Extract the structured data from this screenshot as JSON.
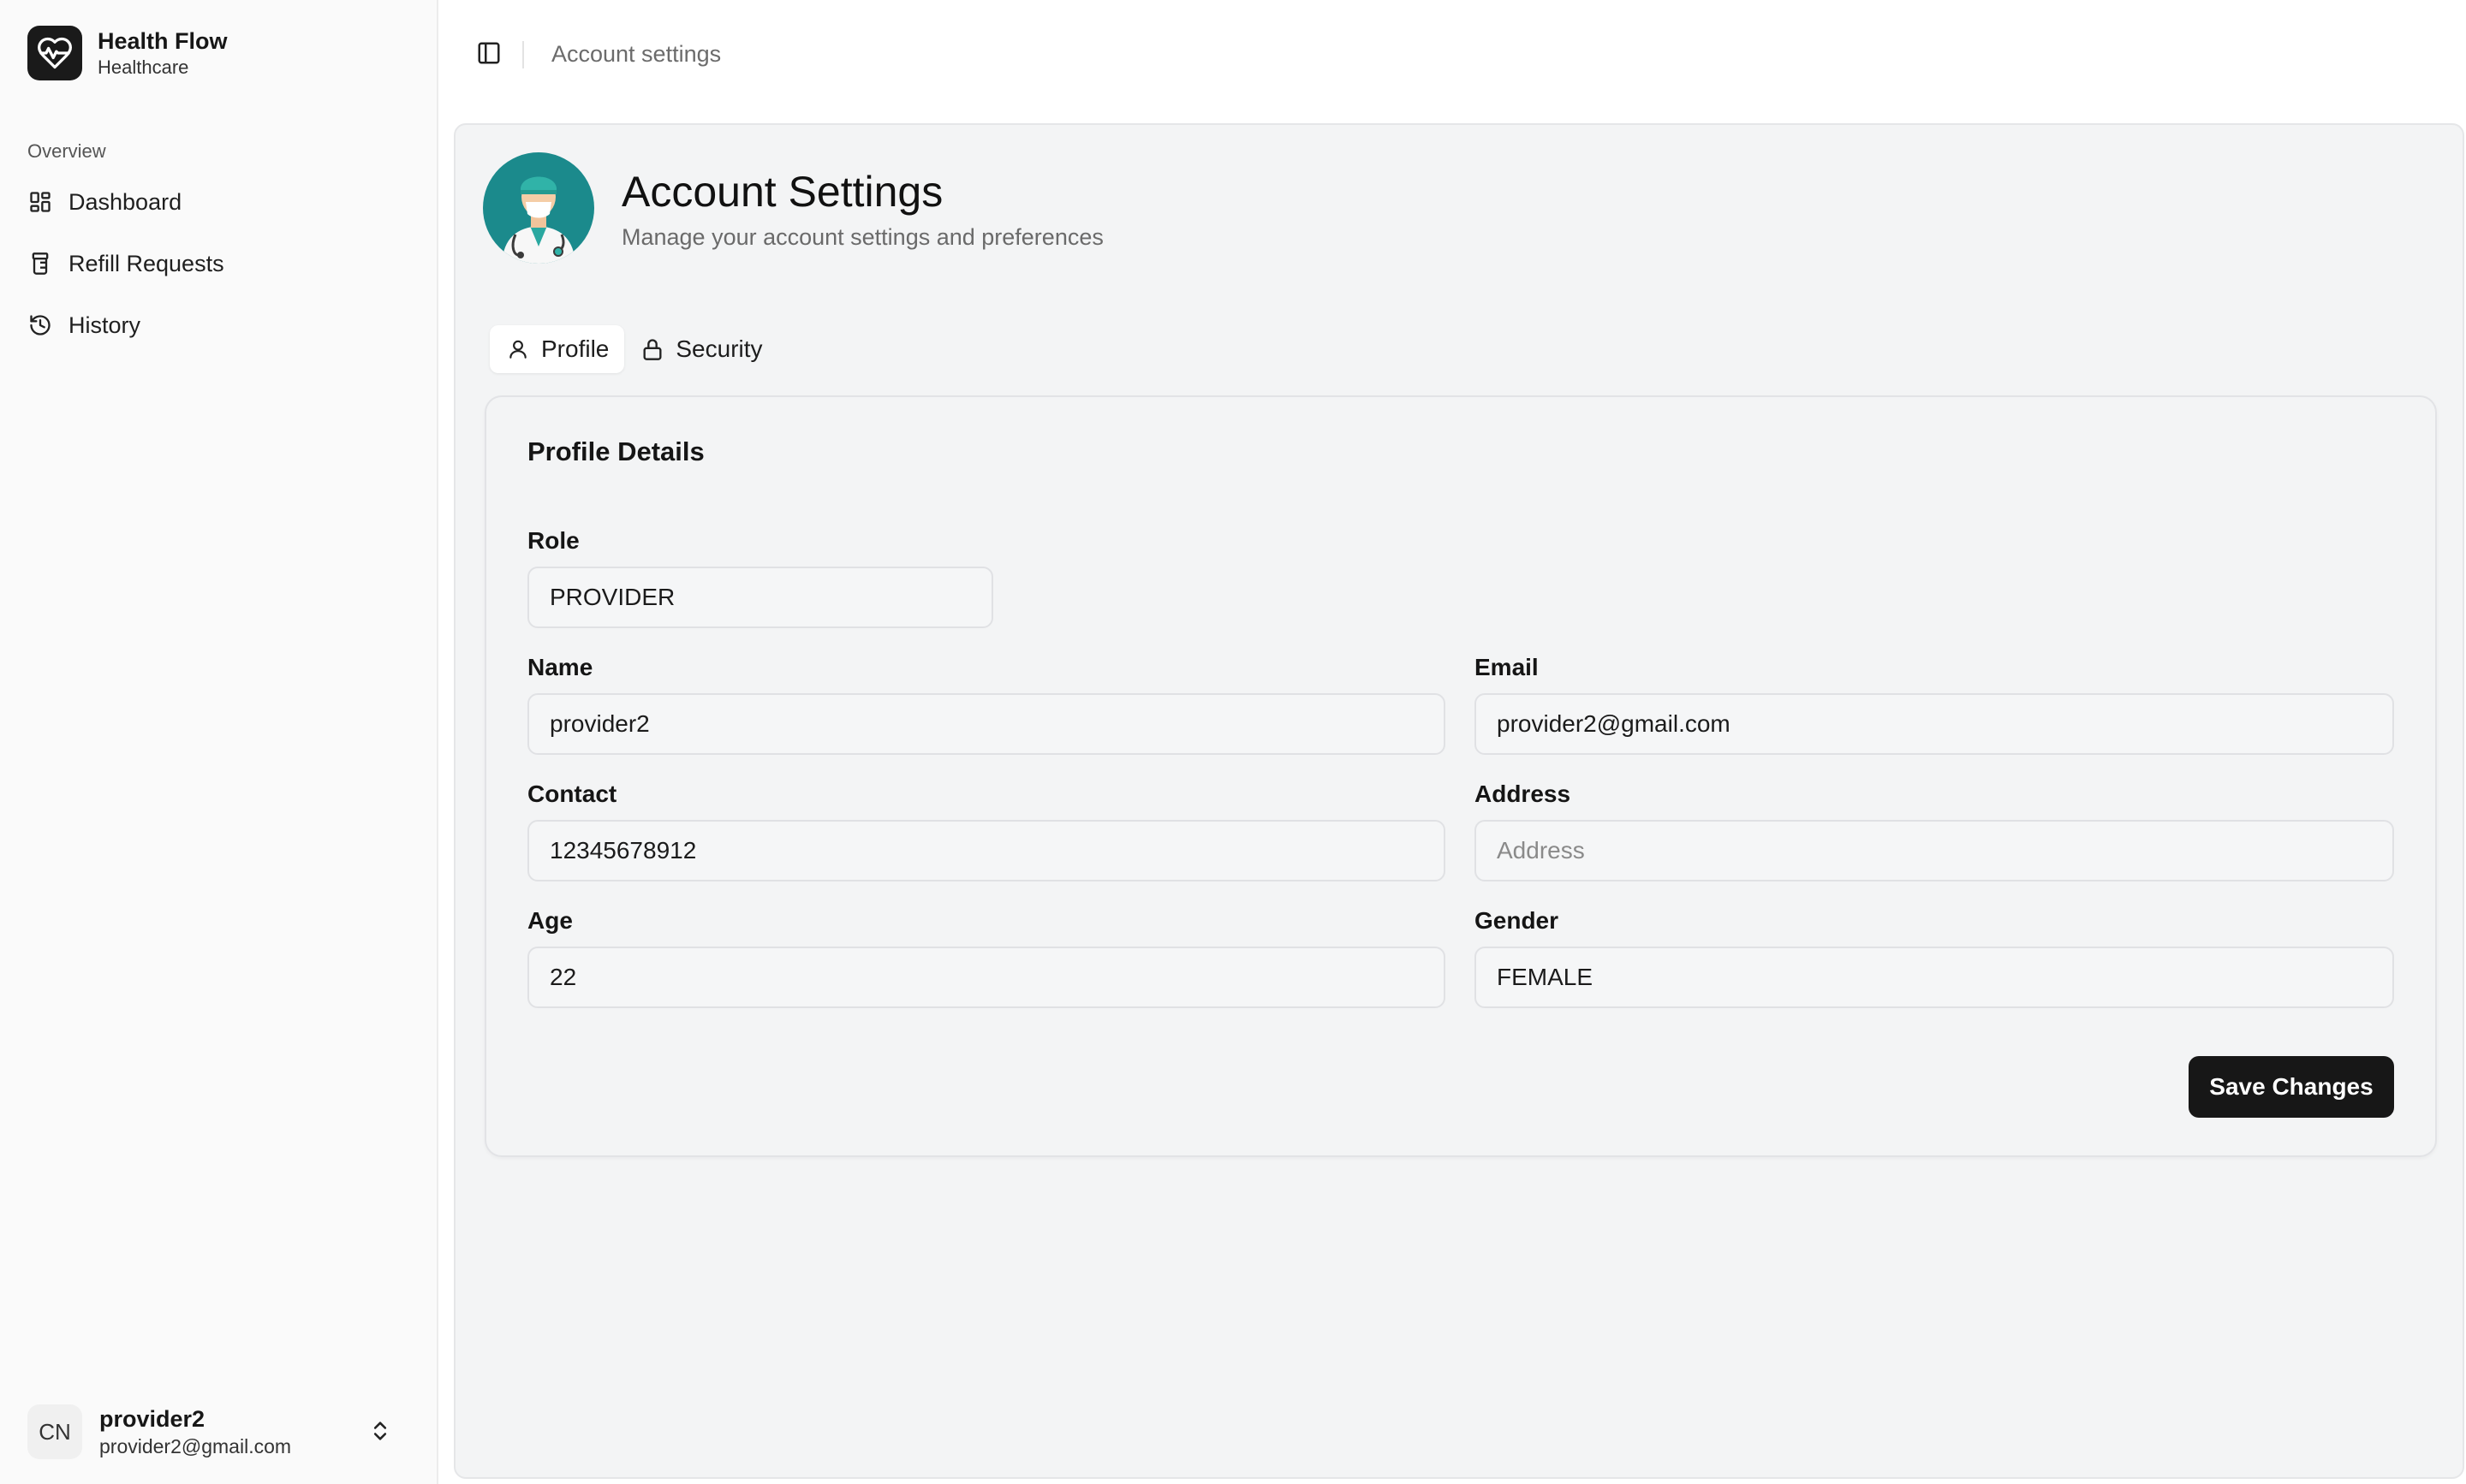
{
  "brand": {
    "name": "Health Flow",
    "subtitle": "Healthcare",
    "icon": "heart-pulse-icon"
  },
  "sidebar": {
    "group_label": "Overview",
    "items": [
      {
        "label": "Dashboard",
        "icon": "dashboard-grid-icon"
      },
      {
        "label": "Refill Requests",
        "icon": "pill-bottle-icon"
      },
      {
        "label": "History",
        "icon": "history-icon"
      }
    ],
    "user": {
      "initials": "CN",
      "name": "provider2",
      "email": "provider2@gmail.com"
    }
  },
  "header": {
    "breadcrumb": "Account settings"
  },
  "page": {
    "title": "Account Settings",
    "subtitle": "Manage your account settings and preferences"
  },
  "tabs": [
    {
      "label": "Profile",
      "icon": "user-icon",
      "active": true
    },
    {
      "label": "Security",
      "icon": "lock-icon",
      "active": false
    }
  ],
  "profile": {
    "title": "Profile Details",
    "role": {
      "label": "Role",
      "value": "PROVIDER"
    },
    "name": {
      "label": "Name",
      "value": "provider2"
    },
    "email": {
      "label": "Email",
      "value": "provider2@gmail.com"
    },
    "contact": {
      "label": "Contact",
      "value": "12345678912"
    },
    "address": {
      "label": "Address",
      "value": "",
      "placeholder": "Address"
    },
    "age": {
      "label": "Age",
      "value": "22"
    },
    "gender": {
      "label": "Gender",
      "value": "FEMALE"
    },
    "save_label": "Save Changes"
  },
  "colors": {
    "accent": "#171717",
    "panel_bg": "#f3f4f5",
    "avatar_teal": "#1b8a8c"
  }
}
